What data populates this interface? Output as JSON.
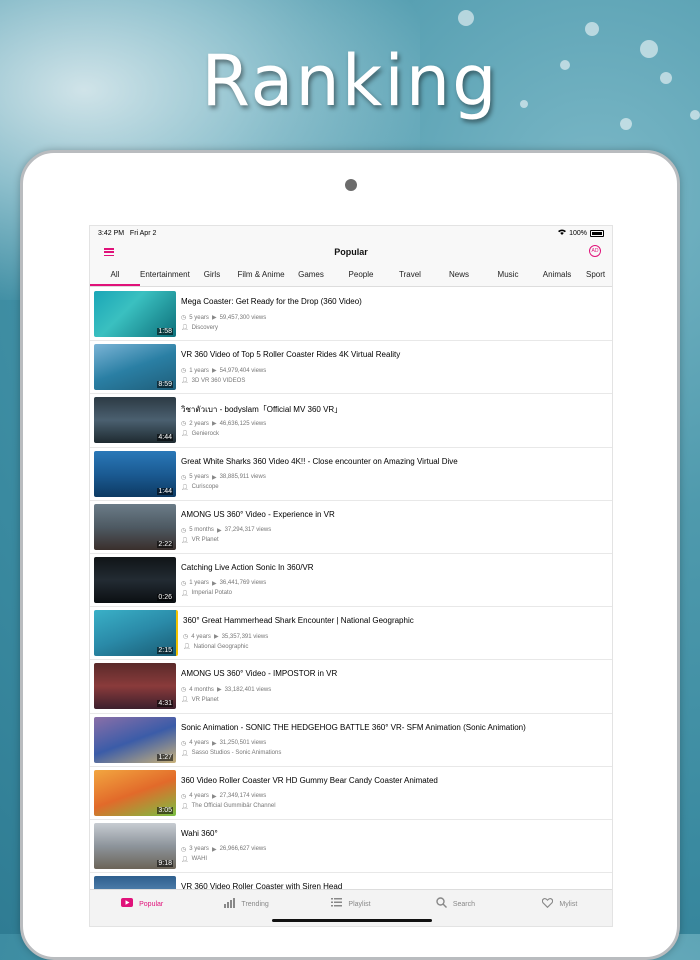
{
  "headline": "Ranking",
  "status": {
    "time": "3:42 PM",
    "date": "Fri Apr 2",
    "battery": "100%"
  },
  "nav": {
    "title": "Popular",
    "ad_label": "AD"
  },
  "tabs": [
    "All",
    "Entertainment",
    "Girls",
    "Film & Anime",
    "Games",
    "People",
    "Travel",
    "News",
    "Music",
    "Animals",
    "Sport"
  ],
  "videos": [
    {
      "title": "Mega Coaster: Get Ready for the Drop (360 Video)",
      "age": "5 years",
      "views": "59,457,300 views",
      "channel": "Discovery",
      "duration": "1:58"
    },
    {
      "title": "VR 360 Video of Top 5 Roller Coaster Rides 4K Virtual Reality",
      "age": "1 years",
      "views": "54,979,404 views",
      "channel": "3D VR 360 VIDEOS",
      "duration": "8:59"
    },
    {
      "title": "วิชาตัวเบา - bodyslam「Official MV 360 VR」",
      "age": "2 years",
      "views": "46,636,125 views",
      "channel": "Genierock",
      "duration": "4:44"
    },
    {
      "title": "Great White Sharks 360 Video 4K!! - Close encounter on Amazing Virtual Dive",
      "age": "5 years",
      "views": "38,885,911 views",
      "channel": "Curiscope",
      "duration": "1:44"
    },
    {
      "title": "AMONG US 360° Video - Experience in VR",
      "age": "5 months",
      "views": "37,294,317 views",
      "channel": "VR Planet",
      "duration": "2:22"
    },
    {
      "title": "Catching Live Action Sonic In 360/VR",
      "age": "1 years",
      "views": "36,441,769 views",
      "channel": "Imperial Potato",
      "duration": "0:26"
    },
    {
      "title": "360° Great Hammerhead Shark Encounter | National Geographic",
      "age": "4 years",
      "views": "35,357,391 views",
      "channel": "National Geographic",
      "duration": "2:15"
    },
    {
      "title": "AMONG US 360° Video - IMPOSTOR in VR",
      "age": "4 months",
      "views": "33,182,401 views",
      "channel": "VR Planet",
      "duration": "4:31"
    },
    {
      "title": "Sonic Animation - SONIC THE HEDGEHOG BATTLE 360° VR- SFM Animation (Sonic Animation)",
      "age": "4 years",
      "views": "31,250,501 views",
      "channel": "Sasso Studios - Sonic Animations",
      "duration": "1:27"
    },
    {
      "title": "360 Video Roller Coaster VR HD Gummy Bear Candy Coaster Animated",
      "age": "4 years",
      "views": "27,349,174 views",
      "channel": "The Official Gummibär Channel",
      "duration": "3:05"
    },
    {
      "title": "Wahi 360°",
      "age": "3 years",
      "views": "26,966,627 views",
      "channel": "WAHI",
      "duration": "9:18"
    },
    {
      "title": "VR 360 Video Roller Coaster with Siren Head",
      "age": "",
      "views": "",
      "channel": "",
      "duration": ""
    }
  ],
  "bottom_tabs": [
    {
      "label": "Popular",
      "icon": "youtube-play-icon",
      "active": true
    },
    {
      "label": "Trending",
      "icon": "bar-chart-icon",
      "active": false
    },
    {
      "label": "Playlist",
      "icon": "list-icon",
      "active": false
    },
    {
      "label": "Search",
      "icon": "search-icon",
      "active": false
    },
    {
      "label": "Mylist",
      "icon": "heart-icon",
      "active": false
    }
  ],
  "colors": {
    "accent": "#e0127a"
  }
}
